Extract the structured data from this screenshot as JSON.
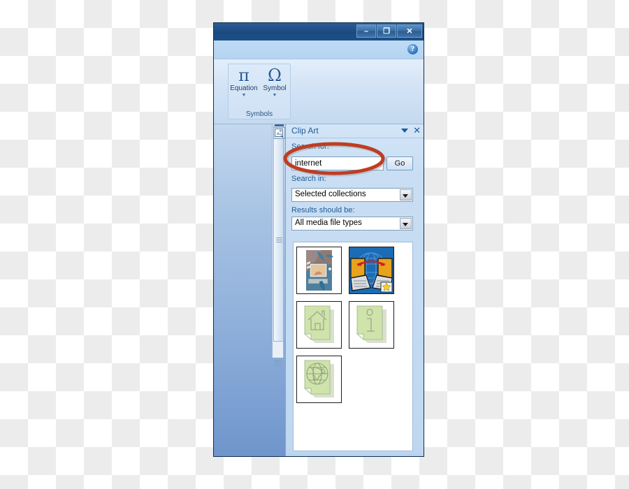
{
  "window": {
    "titlebar_buttons": [
      {
        "name": "minimize",
        "glyph": "–"
      },
      {
        "name": "restore",
        "glyph": "❐"
      },
      {
        "name": "close",
        "glyph": "✕"
      }
    ],
    "help_glyph": "?"
  },
  "ribbon": {
    "group_title": "Symbols",
    "buttons": [
      {
        "glyph": "π",
        "label": "Equation",
        "caret": "▼"
      },
      {
        "glyph": "Ω",
        "label": "Symbol",
        "caret": "▼"
      }
    ]
  },
  "task_pane": {
    "title": "Clip Art",
    "dropdown_icon": "chevron-down-icon",
    "close_label": "✕",
    "search_for_label": "Search for:",
    "search_value": "internet",
    "search_placeholder": "Search for:",
    "go_label": "Go",
    "search_in_label": "Search in:",
    "search_in_value": "Selected collections",
    "results_should_be_label": "Results should be:",
    "results_should_be_value": "All media file types",
    "results": [
      {
        "name": "clip-computer-people",
        "alt": "Abstract illustration of people with a computer monitor"
      },
      {
        "name": "clip-laptops-globe",
        "alt": "Two laptops exchanging data over a globe",
        "badge": "star"
      },
      {
        "name": "clip-page-house",
        "alt": "Green page with house outline"
      },
      {
        "name": "clip-page-info",
        "alt": "Green page with information letter i"
      },
      {
        "name": "clip-page-globe",
        "alt": "Green page with globe outline"
      }
    ]
  },
  "annotation": {
    "shape": "ellipse",
    "color": "#bf3d22",
    "target": "search-input"
  },
  "colors": {
    "titlebar": "#1b4a80",
    "ribbon": "#d3e4f6",
    "pane": "#c9def3",
    "accent_text": "#1f5b96",
    "annotation_red": "#bf3d22",
    "clip_page_green": "#cfe3ab"
  }
}
